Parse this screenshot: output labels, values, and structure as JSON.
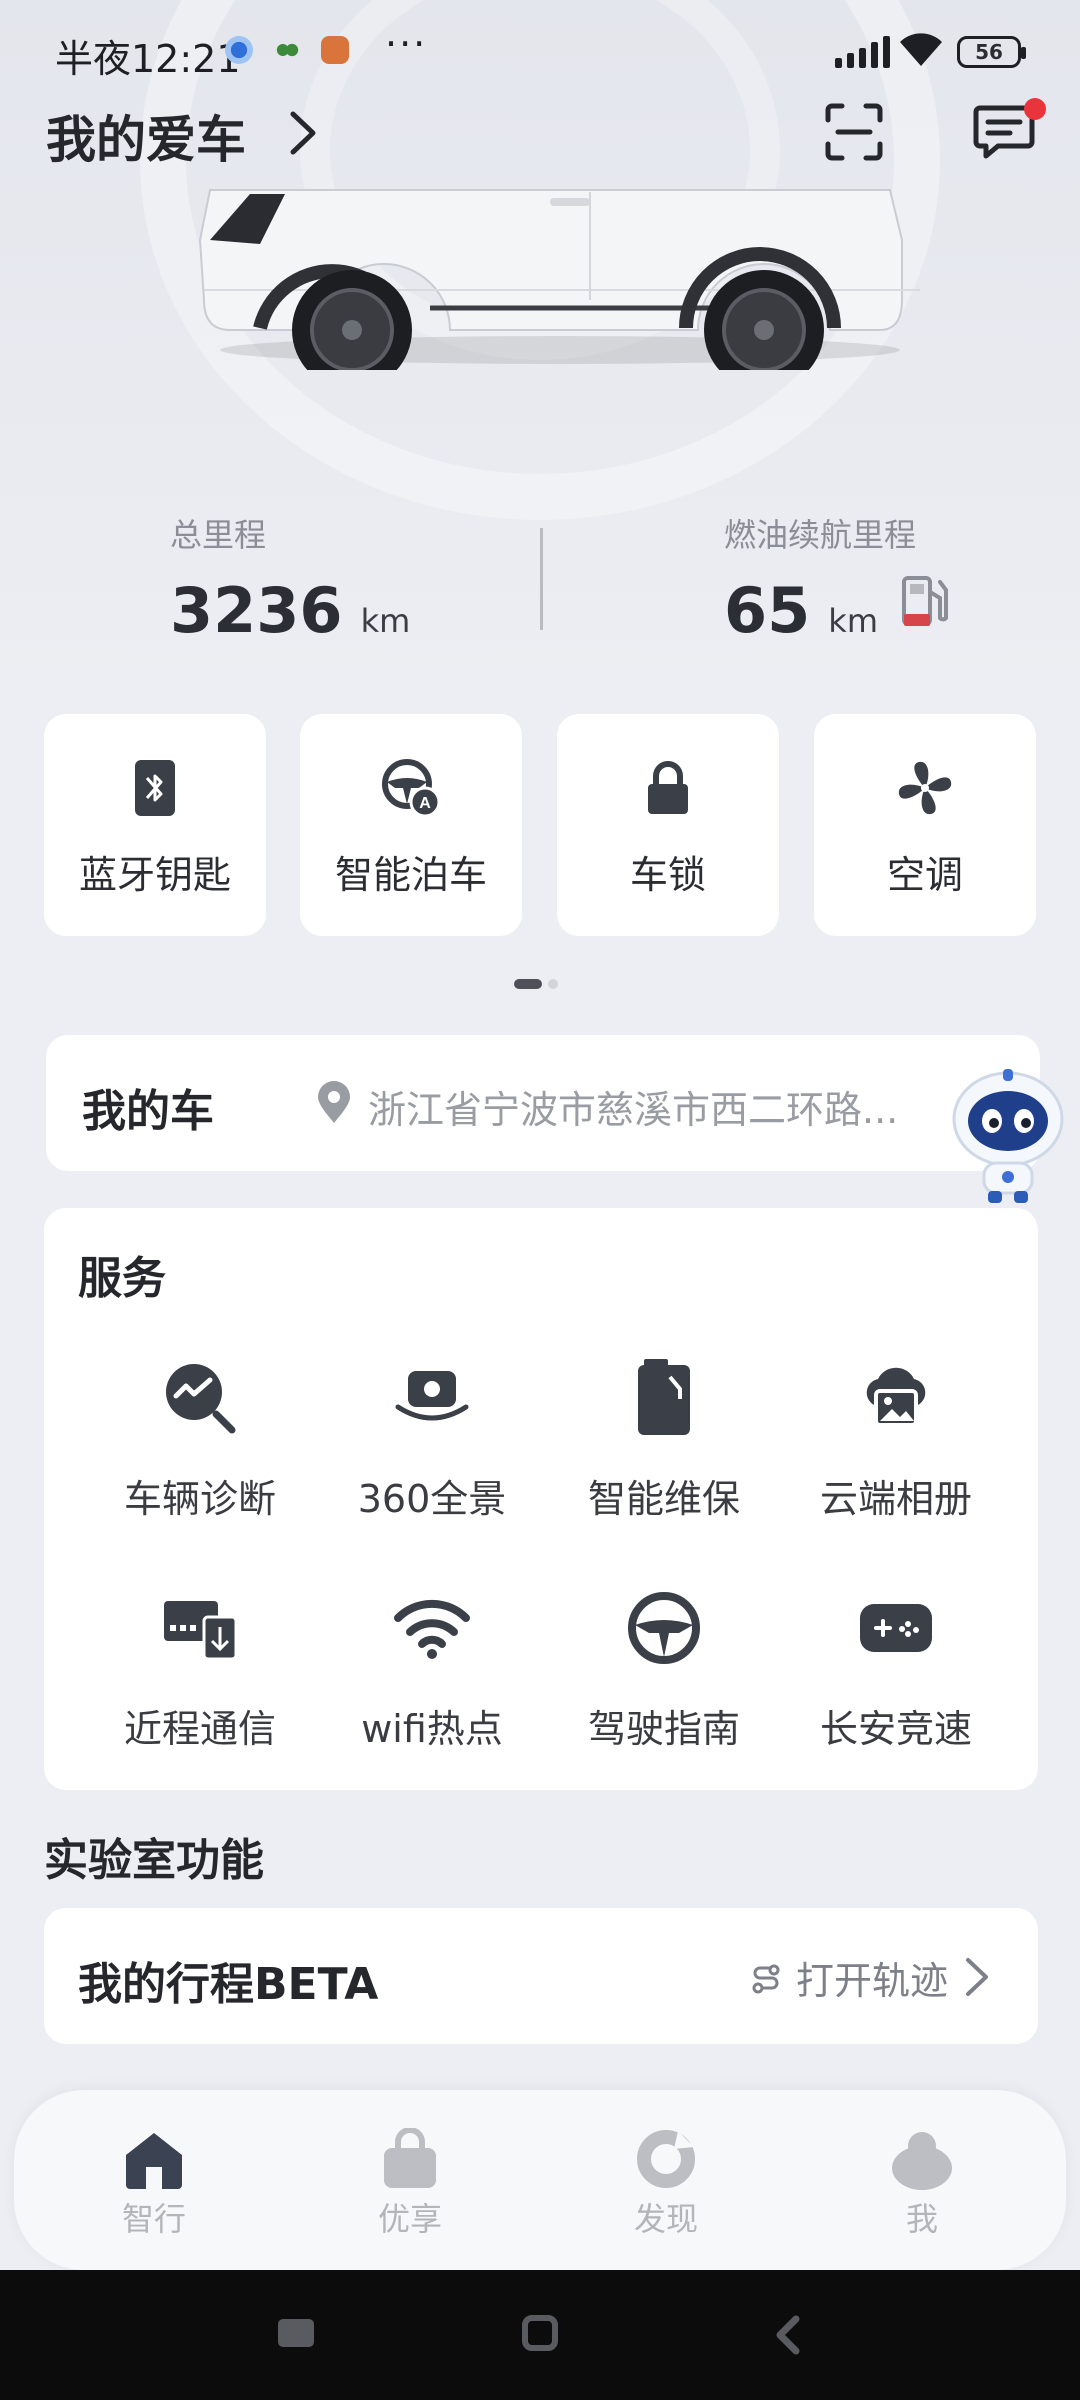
{
  "status_bar": {
    "time": "半夜12:21",
    "dots": "···",
    "battery": "56"
  },
  "header": {
    "title": "我的爱车"
  },
  "mileage": {
    "total_label": "总里程",
    "total_value": "3236",
    "total_unit": "km",
    "range_label": "燃油续航里程",
    "range_value": "65",
    "range_unit": "km"
  },
  "quick_actions": [
    {
      "label": "蓝牙钥匙",
      "icon": "bluetooth-key-icon"
    },
    {
      "label": "智能泊车",
      "icon": "auto-parking-icon"
    },
    {
      "label": "车锁",
      "icon": "lock-icon"
    },
    {
      "label": "空调",
      "icon": "fan-icon"
    }
  ],
  "my_car": {
    "title": "我的车",
    "address": "浙江省宁波市慈溪市西二环路..."
  },
  "services": {
    "title": "服务",
    "items": [
      {
        "label": "车辆诊断",
        "icon": "diagnosis-icon"
      },
      {
        "label": "360全景",
        "icon": "panorama-camera-icon"
      },
      {
        "label": "智能维保",
        "icon": "maintenance-icon"
      },
      {
        "label": "云端相册",
        "icon": "cloud-album-icon"
      },
      {
        "label": "近程通信",
        "icon": "near-comm-icon"
      },
      {
        "label": "wifi热点",
        "icon": "wifi-icon"
      },
      {
        "label": "驾驶指南",
        "icon": "steering-wheel-icon"
      },
      {
        "label": "长安竞速",
        "icon": "gamepad-icon"
      }
    ]
  },
  "lab": {
    "title": "实验室功能",
    "item_name": "我的行程BETA",
    "item_action": "打开轨迹"
  },
  "bottom_nav": [
    {
      "label": "智行",
      "icon": "home-icon",
      "active": true
    },
    {
      "label": "优享",
      "icon": "bag-icon",
      "active": false
    },
    {
      "label": "发现",
      "icon": "discover-icon",
      "active": false
    },
    {
      "label": "我",
      "icon": "user-icon",
      "active": false
    }
  ],
  "colors": {
    "icon_dark": "#3b3f48",
    "notification_dot": "#e8343a",
    "card_bg": "#ffffff",
    "page_bg": "#eceef3"
  }
}
